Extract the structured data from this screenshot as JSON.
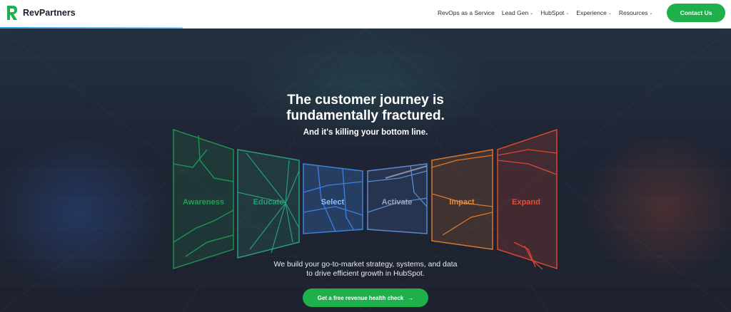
{
  "header": {
    "brand": "RevPartners",
    "nav": [
      {
        "label": "RevOps as a Service",
        "has_dropdown": false
      },
      {
        "label": "Lead Gen",
        "has_dropdown": true
      },
      {
        "label": "HubSpot",
        "has_dropdown": true
      },
      {
        "label": "Experience",
        "has_dropdown": true
      },
      {
        "label": "Resources",
        "has_dropdown": true
      }
    ],
    "cta_label": "Contact Us"
  },
  "hero": {
    "headline_line1": "The customer journey is",
    "headline_line2": "fundamentally fractured.",
    "subhead": "And it's killing your bottom line.",
    "stages": [
      {
        "label": "Awareness",
        "color": "#1f8f4e"
      },
      {
        "label": "Educate",
        "color": "#2a9d7a"
      },
      {
        "label": "Select",
        "color": "#3b82e0"
      },
      {
        "label": "Activate",
        "color": "#5a8ad0"
      },
      {
        "label": "Impact",
        "color": "#d9762f"
      },
      {
        "label": "Expand",
        "color": "#d9472f"
      }
    ],
    "description_line1": "We build your go-to-market strategy, systems, and data",
    "description_line2": "to drive efficient growth in HubSpot.",
    "cta_label": "Get a free revenue health check",
    "cta_icon": "arrow-right-icon"
  },
  "colors": {
    "brand_green": "#1fb04b",
    "background": "#1e2230"
  }
}
